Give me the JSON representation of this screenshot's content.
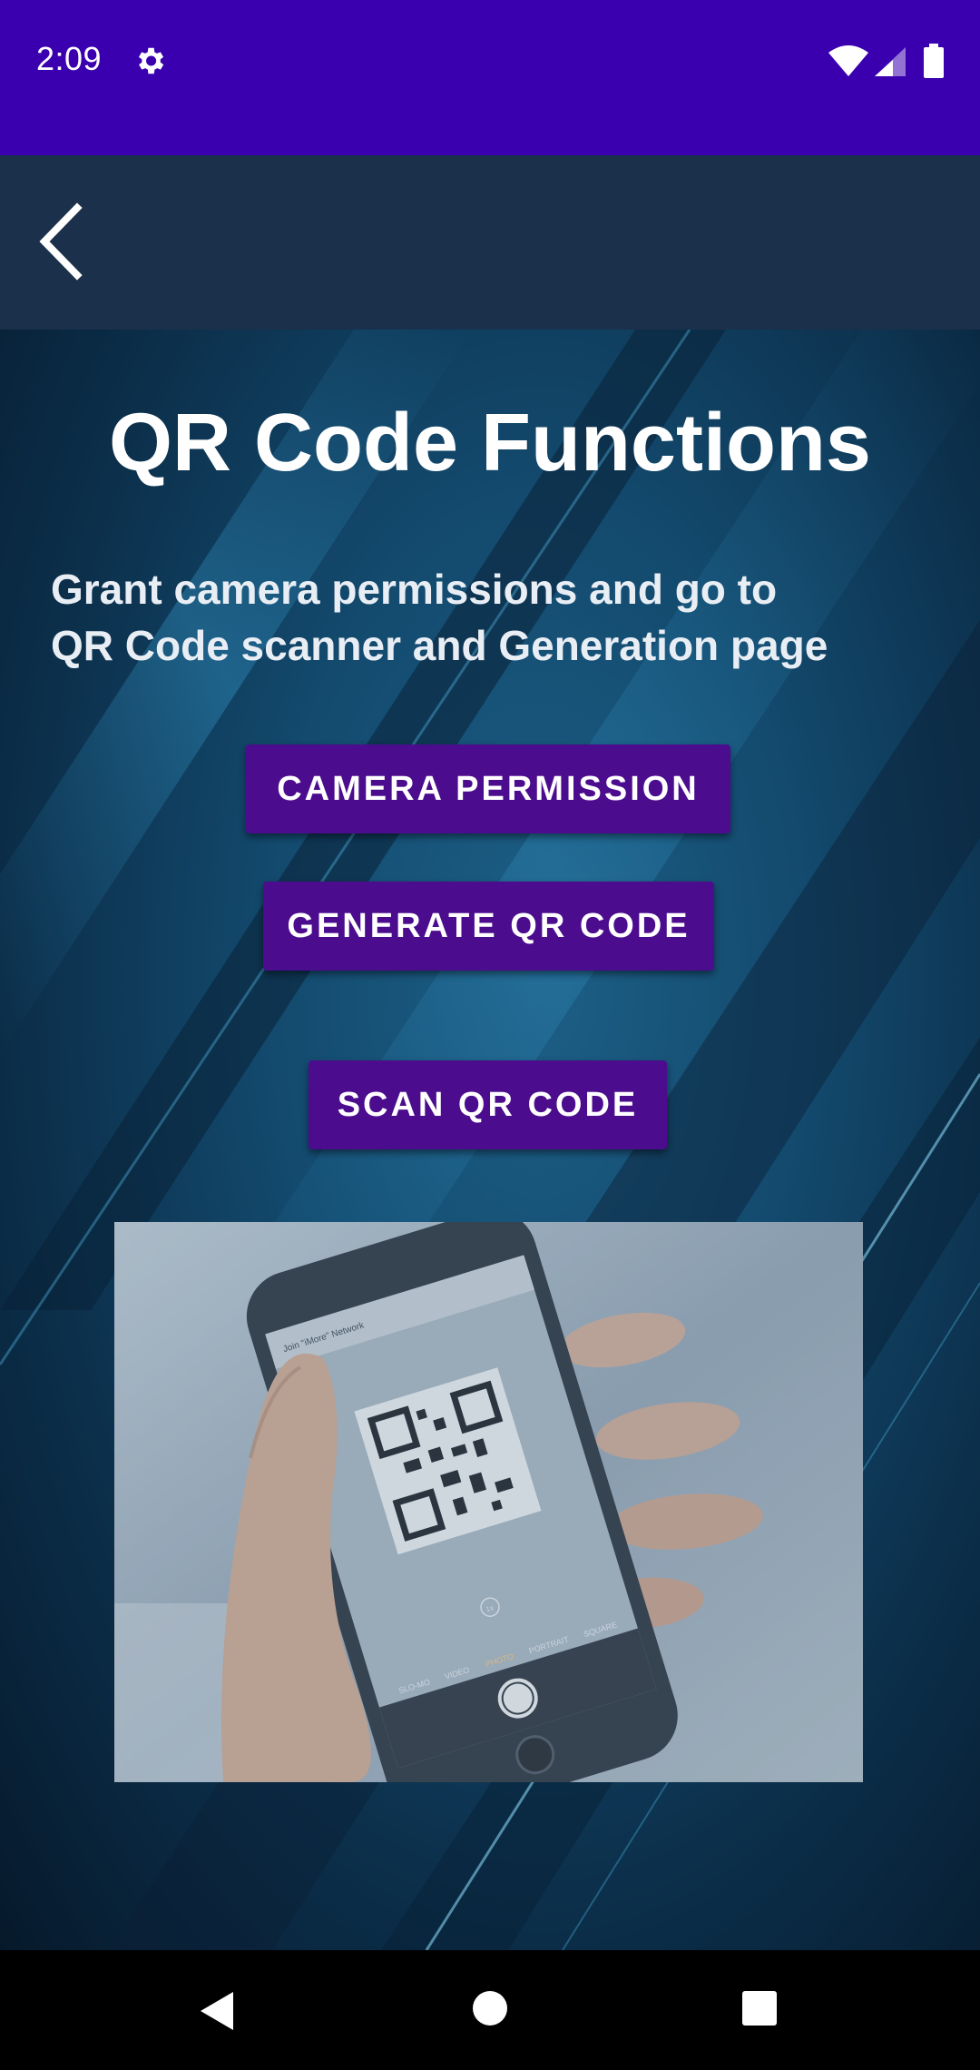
{
  "status_bar": {
    "time": "2:09",
    "icons": [
      "gear-icon",
      "wifi-icon",
      "signal-icon",
      "battery-icon"
    ]
  },
  "app_bar": {
    "back_icon": "chevron-left-icon"
  },
  "main": {
    "title": "QR Code Functions",
    "subtitle_line1": "Grant camera permissions and go to",
    "subtitle_line2": "QR Code scanner and Generation page",
    "buttons": {
      "camera_permission": "CAMERA PERMISSION",
      "generate_qr": "GENERATE QR CODE",
      "scan_qr": "SCAN QR CODE"
    },
    "illustration": {
      "notification_text": "Join \"iMore\" Network",
      "camera_modes": [
        "SLO-MO",
        "VIDEO",
        "PHOTO",
        "PORTRAIT",
        "SQUARE"
      ],
      "zoom": "1x"
    }
  },
  "nav_bar": {
    "icons": [
      "back-triangle-icon",
      "home-circle-icon",
      "recents-square-icon"
    ]
  },
  "colors": {
    "status_bar": "#3a00b0",
    "app_bar": "#1b304a",
    "button": "#4b0c8e",
    "nav_bar": "#000000"
  }
}
